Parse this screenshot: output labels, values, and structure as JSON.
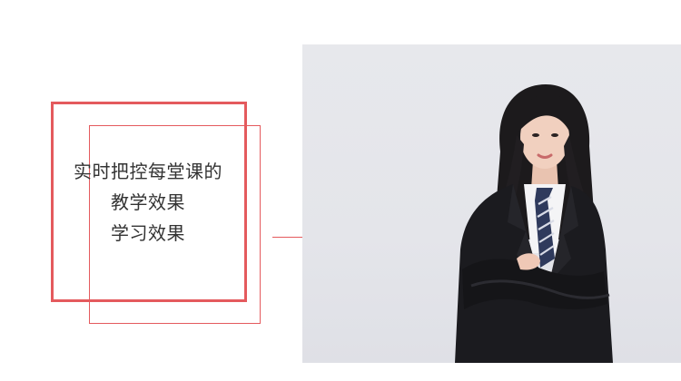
{
  "slogan": {
    "line1": "实时把控每堂课的",
    "line2": "教学效果",
    "line3": "学习效果"
  },
  "colors": {
    "accent": "#e45a5d",
    "text": "#333333",
    "photo_background": "#e5e6eb"
  },
  "photo": {
    "subject": "woman-in-business-suit"
  }
}
